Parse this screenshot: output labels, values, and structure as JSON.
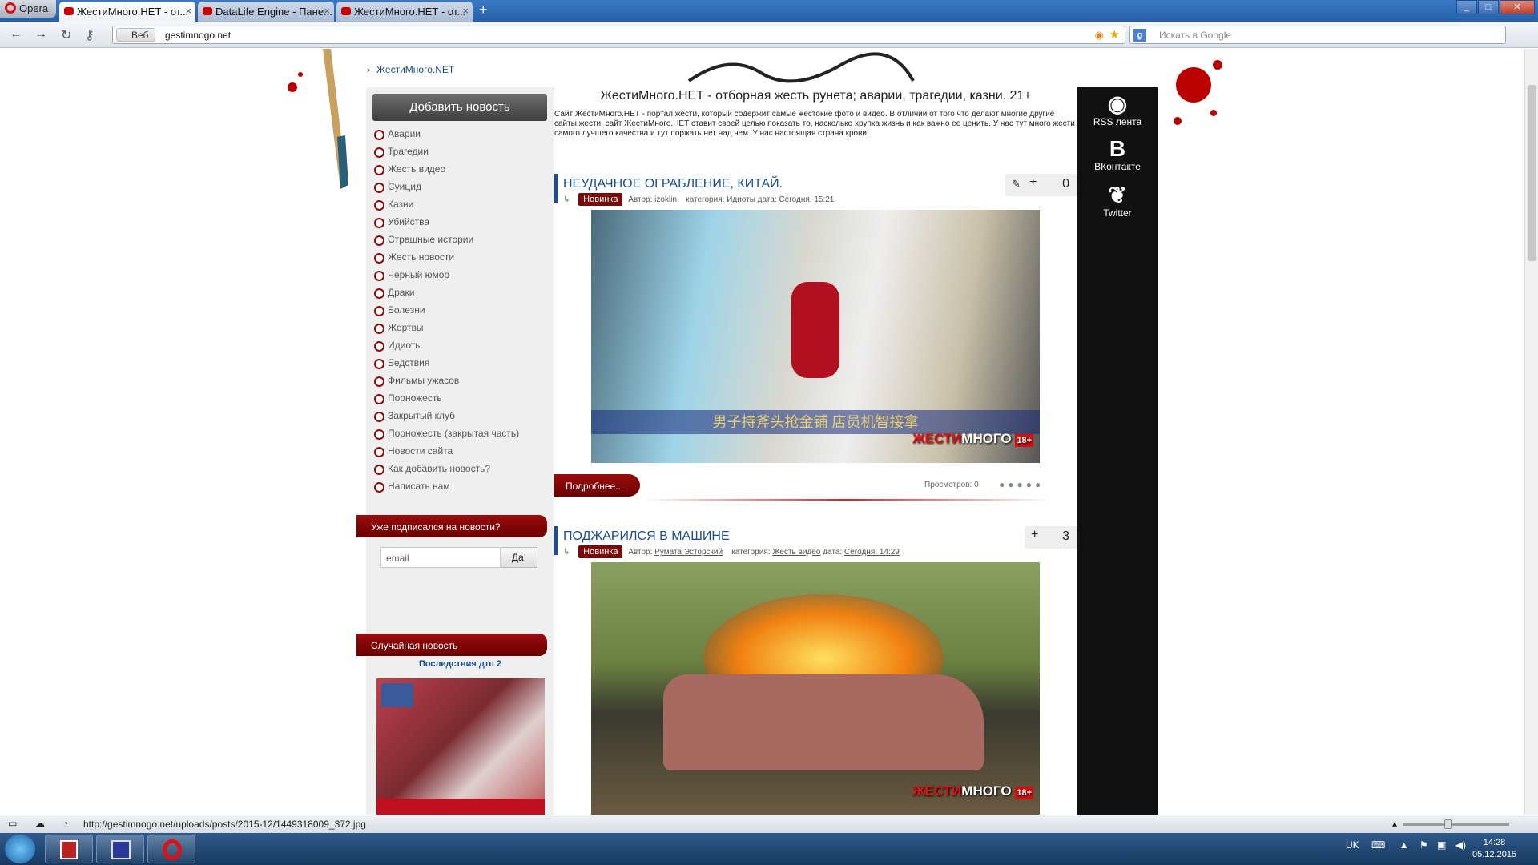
{
  "browser": {
    "menu_label": "Opera",
    "tabs": [
      {
        "label": "ЖестиМного.НЕТ - от...",
        "active": true
      },
      {
        "label": "DataLife Engine - Пане...",
        "active": false
      },
      {
        "label": "ЖестиМного.НЕТ - от...",
        "active": false
      }
    ],
    "address": {
      "web_label": "Веб",
      "url": "gestimnogo.net"
    },
    "search_placeholder": "Искать в Google",
    "status_url": "http://gestimnogo.net/uploads/posts/2015-12/1449318009_372.jpg"
  },
  "page": {
    "breadcrumb": "ЖестиМного.NET",
    "site_title": "ЖестиМного.НЕТ - отборная жесть рунета; аварии, трагедии, казни. 21+",
    "site_description": "Сайт ЖестиМного.НЕТ - портал жести, который содержит самые жестокие фото и видео. В отличии от того что делают многие другие сайты жести, сайт ЖестиМного.НЕТ ставит своей целью показать то, насколько хрупка жизнь и как важно ее ценить. У нас тут много жести самого лучшего качества и тут поржать нет над чем. У нас настоящая страна крови!"
  },
  "sidebar": {
    "add_news": "Добавить новость",
    "menu": [
      "Аварии",
      "Трагедии",
      "Жесть видео",
      "Суицид",
      "Казни",
      "Убийства",
      "Страшные истории",
      "Жесть новости",
      "Черный юмор",
      "Драки",
      "Болезни",
      "Жертвы",
      "Идиоты",
      "Бедствия",
      "Фильмы ужасов",
      "Порножесть",
      "Закрытый клуб",
      "Порножесть (закрытая часть)",
      "Новости сайта",
      "Как добавить новость?",
      "Написать нам"
    ],
    "subscribe": {
      "title": "Уже подписался на новости?",
      "placeholder": "email",
      "button": "Да!"
    },
    "random": {
      "title": "Случайная новость",
      "news_title": "Последствия дтп 2"
    }
  },
  "articles": [
    {
      "title": "НЕУДАЧНОЕ ОГРАБЛЕНИЕ, КИТАЙ.",
      "badge": "Новинка",
      "author_label": "Автор:",
      "author": "izoklin",
      "category_label": "категория:",
      "category": "Идиоты",
      "date_label": "дата:",
      "date": "Сегодня, 15:21",
      "count": "0",
      "more": "Подробнее...",
      "views": "Просмотров: 0",
      "caption": "男子持斧头抢金铺 店员机智接拿"
    },
    {
      "title": "ПОДЖАРИЛСЯ В МАШИНЕ",
      "badge": "Новинка",
      "author_label": "Автор:",
      "author": "Румата Эсторский",
      "category_label": "категория:",
      "category": "Жесть видео",
      "date_label": "дата:",
      "date": "Сегодня, 14:29",
      "count": "3"
    }
  ],
  "watermark": {
    "red": "ЖЕСТИ",
    "white": "МНОГО",
    "age": "18+"
  },
  "social": [
    {
      "icon": "rss-icon",
      "label": "RSS лента"
    },
    {
      "icon": "vk-icon",
      "label": "ВКонтакте"
    },
    {
      "icon": "twitter-icon",
      "label": "Twitter"
    }
  ],
  "taskbar": {
    "lang": "UK",
    "time": "14:28",
    "date": "05.12.2015"
  },
  "colors": {
    "accent": "#1a4f8f",
    "ribbon": "#8a0a0a",
    "social_bg": "#111111"
  }
}
